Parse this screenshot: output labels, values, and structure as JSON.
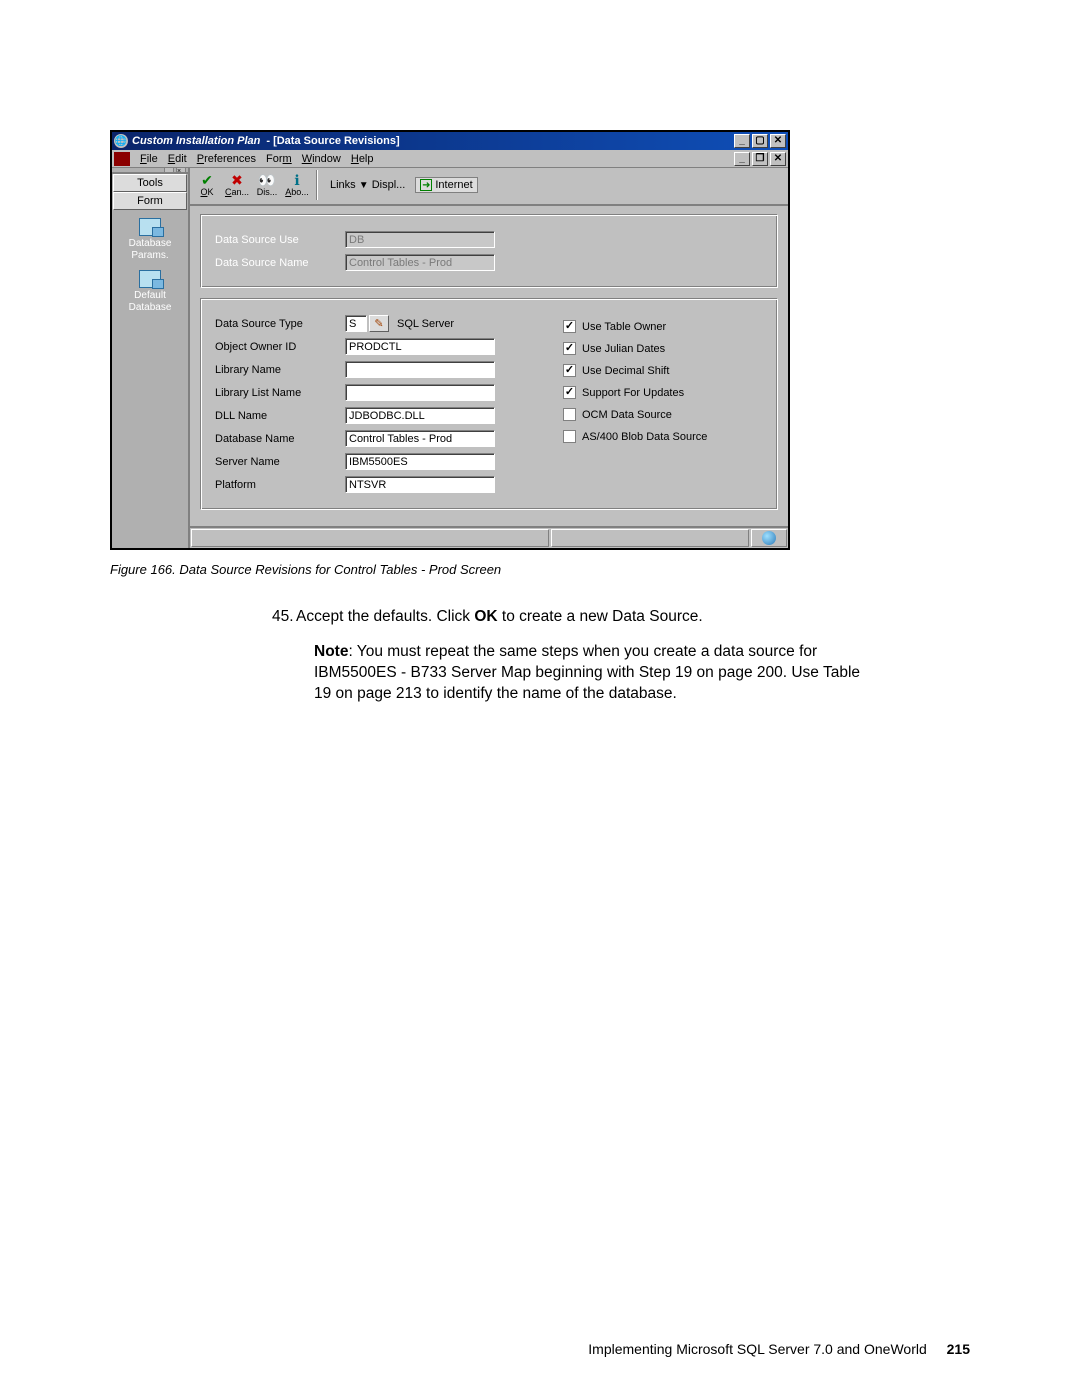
{
  "window": {
    "app_title": "Custom Installation Plan",
    "sub_title": "- [Data Source Revisions]"
  },
  "menus": {
    "file": "File",
    "edit": "Edit",
    "preferences": "Preferences",
    "form": "Form",
    "window": "Window",
    "help": "Help"
  },
  "sidebar": {
    "tools_tab": "Tools",
    "form_tab": "Form",
    "item1": "Database\nParams.",
    "item2": "Default\nDatabase"
  },
  "toolbar": {
    "ok": "OK",
    "cancel": "Can...",
    "display": "Dis...",
    "about": "Abo...",
    "links": "Links",
    "displ": "Displ...",
    "internet": "Internet"
  },
  "readonly": {
    "data_source_use_label": "Data Source Use",
    "data_source_use_value": "DB",
    "data_source_name_label": "Data Source Name",
    "data_source_name_value": "Control Tables - Prod"
  },
  "fields": {
    "data_source_type_label": "Data Source Type",
    "data_source_type_value": "S",
    "data_source_type_text": "SQL Server",
    "object_owner_id_label": "Object Owner ID",
    "object_owner_id_value": "PRODCTL",
    "library_name_label": "Library Name",
    "library_name_value": "",
    "library_list_name_label": "Library List Name",
    "library_list_name_value": "",
    "dll_name_label": "DLL Name",
    "dll_name_value": "JDBODBC.DLL",
    "database_name_label": "Database Name",
    "database_name_value": "Control Tables - Prod",
    "server_name_label": "Server Name",
    "server_name_value": "IBM5500ES",
    "platform_label": "Platform",
    "platform_value": "NTSVR"
  },
  "checks": {
    "use_table_owner": "Use Table Owner",
    "use_julian_dates": "Use Julian Dates",
    "use_decimal_shift": "Use Decimal Shift",
    "support_for_updates": "Support For Updates",
    "ocm_data_source": "OCM Data Source",
    "as400_blob": "AS/400 Blob Data Source"
  },
  "caption": "Figure 166.  Data Source Revisions for Control Tables - Prod Screen",
  "body": {
    "step_num": "45.",
    "step_text_a": "Accept the defaults. Click ",
    "step_text_bold": "OK",
    "step_text_b": " to create a new Data Source.",
    "note_label": "Note",
    "note_text": ": You must repeat the same steps when you create a data source for IBM5500ES - B733 Server Map beginning with Step 19 on page 200. Use Table 19 on page 213 to identify the name of the database."
  },
  "footer": {
    "text": "Implementing Microsoft SQL Server 7.0 and OneWorld",
    "page": "215"
  }
}
